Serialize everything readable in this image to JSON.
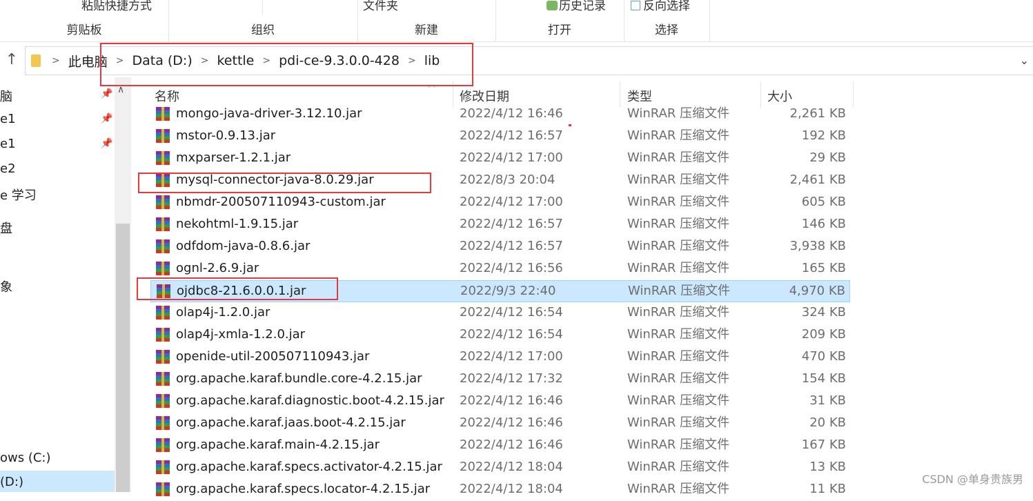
{
  "ribbon": {
    "groups": [
      {
        "label": "剪贴板",
        "top": "粘贴快捷方式"
      },
      {
        "label": "组织",
        "top": ""
      },
      {
        "label": "新建",
        "top": "文件夹"
      },
      {
        "label": "打开",
        "top": "历史记录"
      },
      {
        "label": "选择",
        "top": "反向选择"
      }
    ]
  },
  "address": {
    "crumbs": [
      "此电脑",
      "Data (D:)",
      "kettle",
      "pdi-ce-9.3.0.0-428",
      "lib"
    ]
  },
  "nav": {
    "items": [
      "脑",
      "e1",
      "e1",
      "e2",
      "e 学习",
      "盘",
      "象",
      "ows (C:)",
      "(D:)"
    ]
  },
  "columns": {
    "name": "名称",
    "date": "修改日期",
    "type": "类型",
    "size": "大小"
  },
  "files": [
    {
      "name": "mongo-java-driver-3.12.10.jar",
      "date": "2022/4/12 16:46",
      "type": "WinRAR 压缩文件",
      "size": "2,261 KB"
    },
    {
      "name": "mstor-0.9.13.jar",
      "date": "2022/4/12 16:57",
      "type": "WinRAR 压缩文件",
      "size": "192 KB"
    },
    {
      "name": "mxparser-1.2.1.jar",
      "date": "2022/4/12 17:00",
      "type": "WinRAR 压缩文件",
      "size": "29 KB"
    },
    {
      "name": "mysql-connector-java-8.0.29.jar",
      "date": "2022/8/3 20:04",
      "type": "WinRAR 压缩文件",
      "size": "2,461 KB"
    },
    {
      "name": "nbmdr-200507110943-custom.jar",
      "date": "2022/4/12 17:00",
      "type": "WinRAR 压缩文件",
      "size": "605 KB"
    },
    {
      "name": "nekohtml-1.9.15.jar",
      "date": "2022/4/12 16:57",
      "type": "WinRAR 压缩文件",
      "size": "146 KB"
    },
    {
      "name": "odfdom-java-0.8.6.jar",
      "date": "2022/4/12 16:57",
      "type": "WinRAR 压缩文件",
      "size": "3,938 KB"
    },
    {
      "name": "ognl-2.6.9.jar",
      "date": "2022/4/12 16:56",
      "type": "WinRAR 压缩文件",
      "size": "165 KB"
    },
    {
      "name": "ojdbc8-21.6.0.0.1.jar",
      "date": "2022/9/3 22:40",
      "type": "WinRAR 压缩文件",
      "size": "4,970 KB"
    },
    {
      "name": "olap4j-1.2.0.jar",
      "date": "2022/4/12 16:54",
      "type": "WinRAR 压缩文件",
      "size": "324 KB"
    },
    {
      "name": "olap4j-xmla-1.2.0.jar",
      "date": "2022/4/12 16:54",
      "type": "WinRAR 压缩文件",
      "size": "209 KB"
    },
    {
      "name": "openide-util-200507110943.jar",
      "date": "2022/4/12 17:00",
      "type": "WinRAR 压缩文件",
      "size": "470 KB"
    },
    {
      "name": "org.apache.karaf.bundle.core-4.2.15.jar",
      "date": "2022/4/12 17:32",
      "type": "WinRAR 压缩文件",
      "size": "154 KB"
    },
    {
      "name": "org.apache.karaf.diagnostic.boot-4.2.15.jar",
      "date": "2022/4/12 16:46",
      "type": "WinRAR 压缩文件",
      "size": "31 KB"
    },
    {
      "name": "org.apache.karaf.jaas.boot-4.2.15.jar",
      "date": "2022/4/12 16:46",
      "type": "WinRAR 压缩文件",
      "size": "20 KB"
    },
    {
      "name": "org.apache.karaf.main-4.2.15.jar",
      "date": "2022/4/12 16:46",
      "type": "WinRAR 压缩文件",
      "size": "167 KB"
    },
    {
      "name": "org.apache.karaf.specs.activator-4.2.15.jar",
      "date": "2022/4/12 18:04",
      "type": "WinRAR 压缩文件",
      "size": "13 KB"
    },
    {
      "name": "org.apache.karaf.specs.locator-4.2.15.jar",
      "date": "2022/4/12 18:04",
      "type": "WinRAR 压缩文件",
      "size": "11 KB"
    }
  ],
  "watermark": "CSDN @单身贵族男",
  "colors": {
    "selection": "#cce8ff",
    "highlight_border": "#e8383d",
    "folder": "#f3c74d"
  }
}
